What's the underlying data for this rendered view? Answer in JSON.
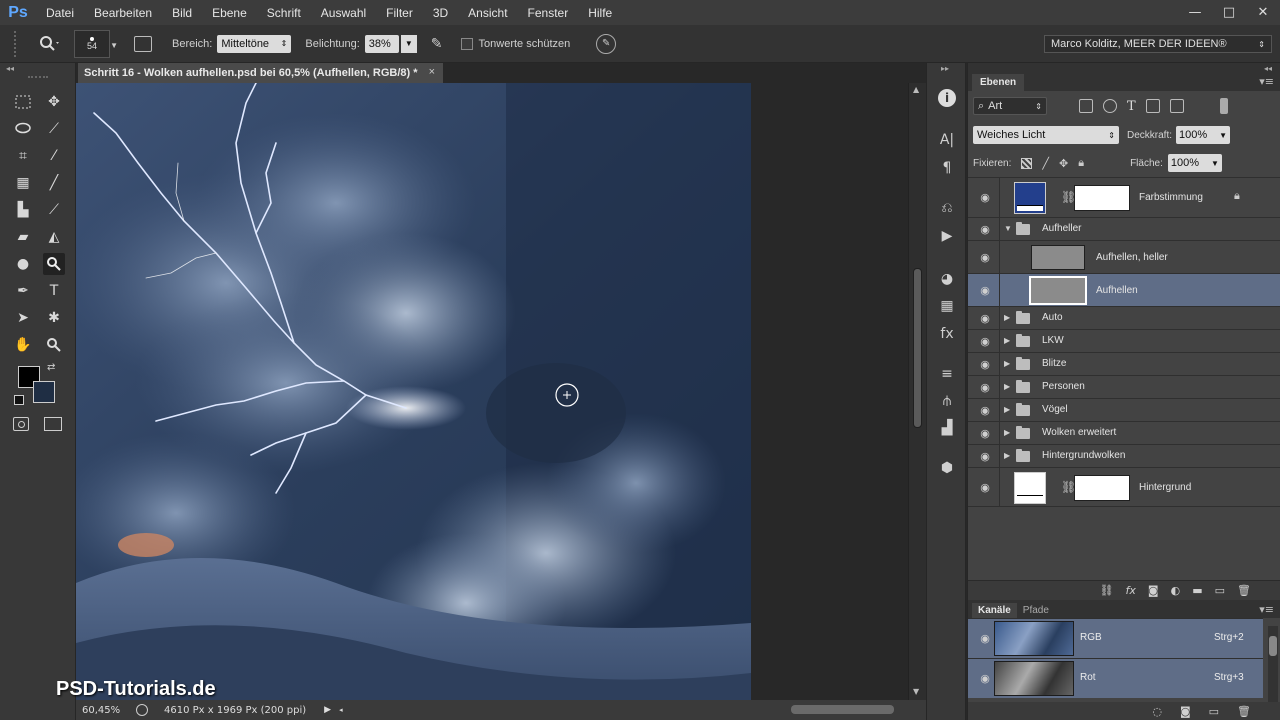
{
  "app": {
    "logo": "Ps"
  },
  "menu": [
    "Datei",
    "Bearbeiten",
    "Bild",
    "Ebene",
    "Schrift",
    "Auswahl",
    "Filter",
    "3D",
    "Ansicht",
    "Fenster",
    "Hilfe"
  ],
  "window_controls": {
    "minimize": "—",
    "maximize": "□",
    "close": "✕"
  },
  "options": {
    "brush_size": "54",
    "range_label": "Bereich:",
    "range_value": "Mitteltöne",
    "exposure_label": "Belichtung:",
    "exposure_value": "38%",
    "protect_tones_label": "Tonwerte schützen",
    "profile": "Marco Kolditz, MEER DER IDEEN®"
  },
  "document": {
    "tab_title": "Schritt 16 - Wolken aufhellen.psd bei 60,5% (Aufhellen, RGB/8) *",
    "close": "×"
  },
  "status": {
    "zoom": "60,45%",
    "doc_size": "4610 Px x 1969 Px (200 ppi)"
  },
  "watermark": "PSD-Tutorials.de",
  "layers_panel": {
    "tab": "Ebenen",
    "filter_kind": "Art",
    "blend_mode": "Weiches Licht",
    "opacity_label": "Deckkraft:",
    "opacity_value": "100%",
    "lock_label": "Fixieren:",
    "fill_label": "Fläche:",
    "fill_value": "100%",
    "layers": [
      {
        "name": "Farbstimmung",
        "kind": "adjustment",
        "color": "#233f8c"
      },
      {
        "name": "Aufheller",
        "kind": "group-open"
      },
      {
        "name": "Aufhellen, heller",
        "kind": "gray-layer"
      },
      {
        "name": "Aufhellen",
        "kind": "gray-layer",
        "selected": true
      },
      {
        "name": "Auto",
        "kind": "group"
      },
      {
        "name": "LKW",
        "kind": "group"
      },
      {
        "name": "Blitze",
        "kind": "group"
      },
      {
        "name": "Personen",
        "kind": "group"
      },
      {
        "name": "Vögel",
        "kind": "group"
      },
      {
        "name": "Wolken erweitert",
        "kind": "group"
      },
      {
        "name": "Hintergrundwolken",
        "kind": "group"
      },
      {
        "name": "Hintergrund",
        "kind": "adjustment",
        "color": "#ffffff"
      }
    ]
  },
  "channels_panel": {
    "tab_channels": "Kanäle",
    "tab_paths": "Pfade",
    "channels": [
      {
        "name": "RGB",
        "shortcut": "Strg+2"
      },
      {
        "name": "Rot",
        "shortcut": "Strg+3"
      }
    ]
  },
  "colors": {
    "accent_selected": "#5f6d87",
    "foreground": "#000000",
    "background": "#1f2e44"
  }
}
